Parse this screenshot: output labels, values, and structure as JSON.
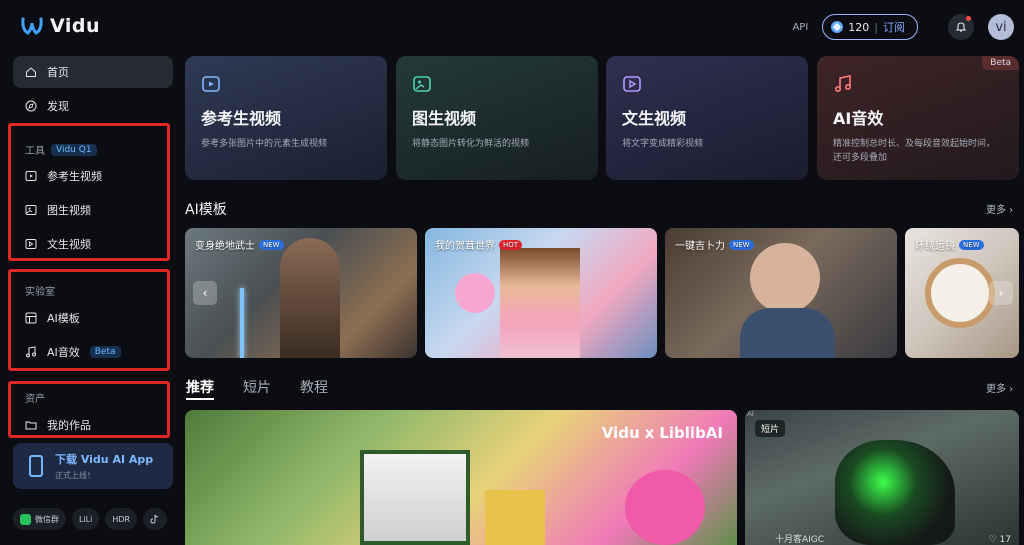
{
  "header": {
    "logo_text": "Vidu",
    "api_label": "API",
    "credits": "120",
    "credit_separator": "|",
    "subscribe_label": "订阅",
    "avatar_text": "vi"
  },
  "sidebar": {
    "home_label": "首页",
    "discover_label": "发现",
    "tools_title": "工具",
    "tools_badge": "Vidu Q1",
    "tools_items": [
      "参考生视频",
      "图生视频",
      "文生视频"
    ],
    "lab_title": "实验室",
    "lab_items": [
      "AI模板",
      "AI音效"
    ],
    "lab_badge": "Beta",
    "assets_title": "资产",
    "assets_items": [
      "我的作品"
    ],
    "download_title": "下载 Vidu AI App",
    "download_sub": "正式上线！",
    "social": [
      "微信群",
      "LiLi",
      "HDR"
    ]
  },
  "feature_cards": [
    {
      "title": "参考生视频",
      "desc": "参考多张图片中的元素生成视频",
      "color": "#2f3a55"
    },
    {
      "title": "图生视频",
      "desc": "将静态图片转化为鲜活的视频",
      "color": "#233a38"
    },
    {
      "title": "文生视频",
      "desc": "将文字变成精彩视频",
      "color": "#312f52"
    },
    {
      "title": "AI音效",
      "desc": "精准控制总时长、及每段音效起始时间，还可多段叠加",
      "color": "#3e2427",
      "tag": "Beta"
    }
  ],
  "templates": {
    "title": "AI模板",
    "more": "更多",
    "items": [
      {
        "label": "变身绝地武士",
        "tag": "NEW"
      },
      {
        "label": "我的贺茸世界",
        "tag": "HOT"
      },
      {
        "label": "一键吉卜力",
        "tag": "NEW"
      },
      {
        "label": "环绕运镜",
        "tag": "NEW"
      }
    ]
  },
  "tabs": {
    "items": [
      "推荐",
      "短片",
      "教程"
    ],
    "active": "推荐",
    "more": "更多"
  },
  "feed": {
    "collab_left": "Vidu",
    "collab_x": "x",
    "collab_right": "LiblibAI",
    "short_tag": "短片",
    "ai_tag": "AI",
    "author": "十月客AIGC",
    "likes": "17"
  }
}
